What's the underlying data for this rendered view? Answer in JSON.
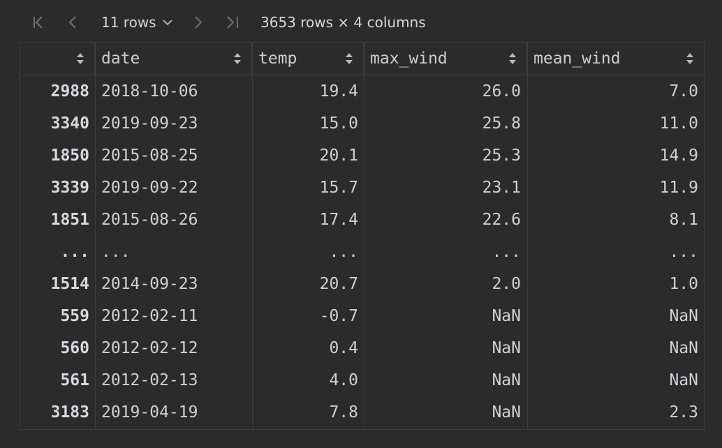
{
  "toolbar": {
    "rows_label": "11 rows",
    "info": "3653 rows × 4 columns"
  },
  "table": {
    "columns": [
      "",
      "date",
      "temp",
      "max_wind",
      "mean_wind"
    ],
    "rows": [
      [
        "2988",
        "2018-10-06",
        "19.4",
        "26.0",
        "7.0"
      ],
      [
        "3340",
        "2019-09-23",
        "15.0",
        "25.8",
        "11.0"
      ],
      [
        "1850",
        "2015-08-25",
        "20.1",
        "25.3",
        "14.9"
      ],
      [
        "3339",
        "2019-09-22",
        "15.7",
        "23.1",
        "11.9"
      ],
      [
        "1851",
        "2015-08-26",
        "17.4",
        "22.6",
        "8.1"
      ],
      [
        "...",
        "...",
        "...",
        "...",
        "..."
      ],
      [
        "1514",
        "2014-09-23",
        "20.7",
        "2.0",
        "1.0"
      ],
      [
        "559",
        "2012-02-11",
        "-0.7",
        "NaN",
        "NaN"
      ],
      [
        "560",
        "2012-02-12",
        "0.4",
        "NaN",
        "NaN"
      ],
      [
        "561",
        "2012-02-13",
        "4.0",
        "NaN",
        "NaN"
      ],
      [
        "3183",
        "2019-04-19",
        "7.8",
        "NaN",
        "2.3"
      ]
    ]
  },
  "icons": {
    "first_page": "first-page-icon",
    "prev_page": "prev-page-icon",
    "next_page": "next-page-icon",
    "last_page": "last-page-icon",
    "dropdown": "chevron-down-icon",
    "sort": "sort-icon"
  }
}
